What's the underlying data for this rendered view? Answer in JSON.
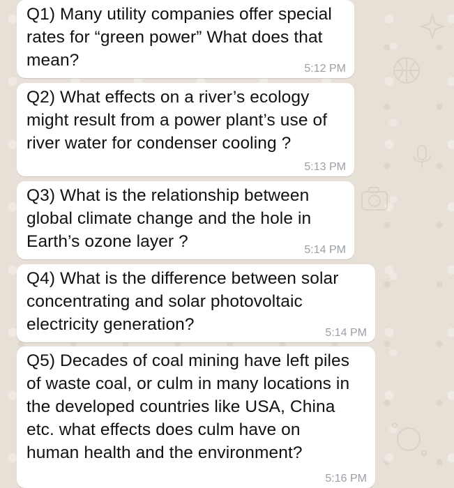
{
  "messages": [
    {
      "text": "Q1) Many utility companies offer special\nrates for “green power” What does that\nmean?",
      "time": "5:12 PM"
    },
    {
      "text": "Q2) What effects on a river’s ecology\nmight result from a power plant’s use of\nriver water for condenser cooling ?",
      "time": "5:13 PM"
    },
    {
      "text": "Q3) What is the relationship between\nglobal climate change and the hole in\nEarth’s ozone layer ?",
      "time": "5:14 PM"
    },
    {
      "text": "Q4) What is the difference between solar\nconcentrating and solar photovoltaic\nelectricity generation?",
      "time": "5:14 PM"
    },
    {
      "text": "Q5) Decades of coal mining have left piles\nof waste coal, or culm in many locations in\nthe developed countries like USA, China\netc. what effects does culm have on\nhuman health and the environment?",
      "time": "5:16 PM"
    }
  ],
  "colors": {
    "wallpaper": "#e7e0d6",
    "bubble": "#ffffff",
    "text": "#111111",
    "timestamp": "#9aa0a6"
  },
  "icons": [
    "star-doodle",
    "basketball-doodle",
    "camera-doodle",
    "mic-doodle",
    "sparkle-doodle"
  ]
}
